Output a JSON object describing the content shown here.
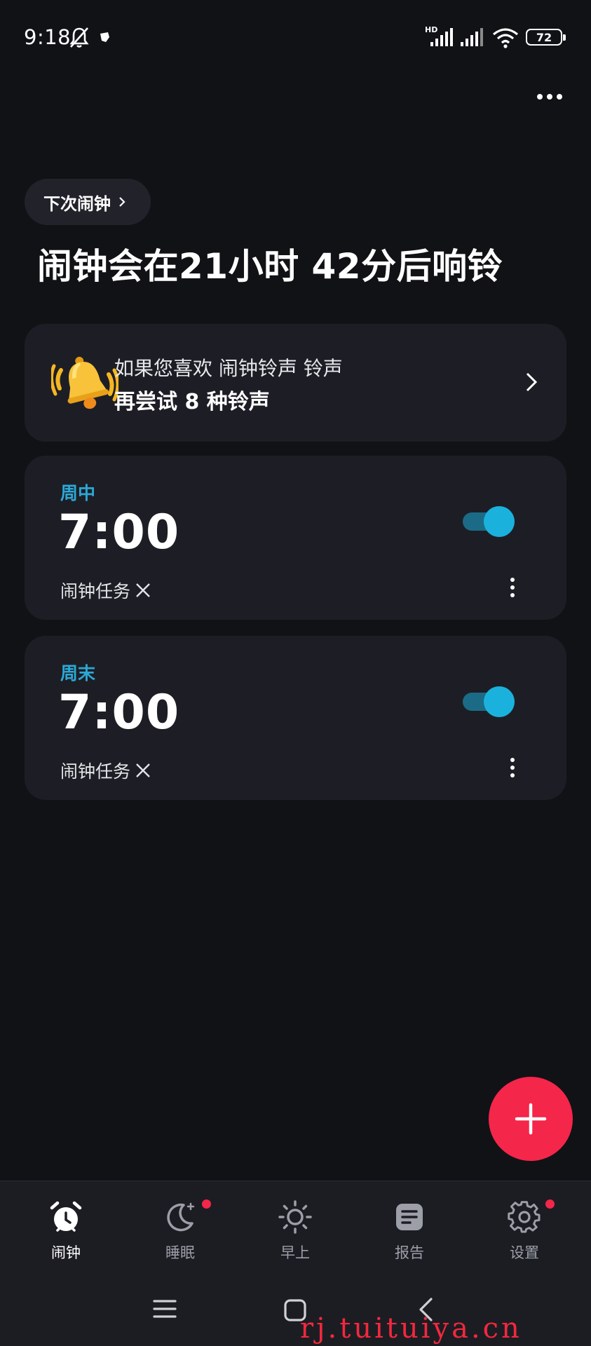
{
  "status_bar": {
    "time": "9:18",
    "network_label": "HD",
    "battery_level": "72",
    "icons": [
      "mute-icon",
      "app-notification-icon",
      "signal-hd-icon",
      "signal-icon",
      "wifi-icon",
      "battery-icon"
    ]
  },
  "header": {
    "next_alarm_chip": "下次闹钟",
    "headline": "闹钟会在21小时 42分后响铃"
  },
  "promo": {
    "line1": "如果您喜欢 闹钟铃声 铃声",
    "line2": "再尝试 8 种铃声"
  },
  "alarms": [
    {
      "label": "周中",
      "time": "7:00",
      "task": "闹钟任务",
      "enabled": true
    },
    {
      "label": "周末",
      "time": "7:00",
      "task": "闹钟任务",
      "enabled": true
    }
  ],
  "bottom_nav": [
    {
      "label": "闹钟",
      "icon": "alarm-clock-icon",
      "active": true,
      "badge": false
    },
    {
      "label": "睡眠",
      "icon": "moon-icon",
      "active": false,
      "badge": true
    },
    {
      "label": "早上",
      "icon": "sun-icon",
      "active": false,
      "badge": false
    },
    {
      "label": "报告",
      "icon": "report-icon",
      "active": false,
      "badge": false
    },
    {
      "label": "设置",
      "icon": "gear-icon",
      "active": false,
      "badge": true
    }
  ],
  "watermark": "rj.tuituiya.cn",
  "colors": {
    "background": "#111216",
    "card": "#1d1e25",
    "accent_blue": "#2ba8d6",
    "fab_red": "#f4264a"
  }
}
